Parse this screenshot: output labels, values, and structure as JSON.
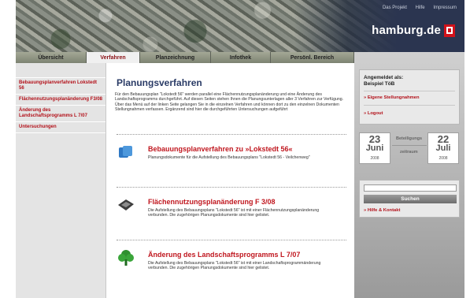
{
  "header": {
    "top_links": [
      "Das Projekt",
      "Hilfe",
      "Impressum"
    ],
    "logo_text": "hamburg.de"
  },
  "tabs": [
    {
      "label": "Übersicht",
      "active": false
    },
    {
      "label": "Verfahren",
      "active": true
    },
    {
      "label": "Planzeichnung",
      "active": false
    },
    {
      "label": "Infothek",
      "active": false
    },
    {
      "label": "Persönl. Bereich",
      "active": false
    }
  ],
  "sidebar": {
    "items": [
      {
        "label": "Bebauungsplanverfahren Lokstedt 56"
      },
      {
        "label": "Flächennutzungsplanänderung F3/08"
      },
      {
        "label": "Änderung des Landschaftsprogramms L 7/07"
      },
      {
        "label": "Untersuchungen"
      }
    ]
  },
  "main": {
    "title": "Planungsverfahren",
    "intro": "Für den Bebauungsplan \"Lokstedt 56\" werden parallel eine Flächennutzungsplanänderung und eine Änderung des Landschaftsprogramms durchgeführt. Auf diesen Seiten stehen Ihnen die Planungsunterlagen aller 3 Verfahren zur Verfügung. Über das Menü auf der linken Seite gelangen Sie in die einzelnen Verfahren und können dort zu den einzelnen Dokumenten Stellungnahmen verfassen. Ergänzend sind hier die durchgeführten Untersuchungen aufgeführt",
    "entries": [
      {
        "title": "Bebauungsplanverfahren zu »Lokstedt 56«",
        "desc": "Planungsdokumente für die Aufstellung des Bebauungsplans \"Lokstedt 56 - Veilchenweg\"",
        "icon": "document-stack-icon"
      },
      {
        "title": "Flächennutzungsplanänderung F 3/08",
        "desc": "Die Aufstellung des Bebauungsplans \"Lokstedt 56\" ist mit einer Flächennutzungsplanänderung verbunden. Die zugehörigen Planungsdokumente sind hier gelistet.",
        "icon": "map-plan-icon"
      },
      {
        "title": "Änderung des Landschaftsprogramms L 7/07",
        "desc": "Die Aufstellung des Bebauungsplans \"Lokstedt 56\" ist mit einer Landschaftsprogrammänderung verbunden. Die zugehörigen Planungsdokumente sind hier gelistet.",
        "icon": "tree-icon"
      }
    ]
  },
  "right": {
    "login_label": "Angemeldet als:",
    "login_user": "Beispiel TöB",
    "link_statements": "» Eigene Stellungnahmen",
    "link_logout": "» Logout",
    "date_start": {
      "day": "23",
      "month": "Juni",
      "year": "2008"
    },
    "date_end": {
      "day": "22",
      "month": "Juli",
      "year": "2008"
    },
    "range_label_1": "Beteiligungs",
    "range_label_2": "zeitraum",
    "search_value": "",
    "search_button": "Suchen",
    "help_link": "» Hilfe & Kontakt"
  },
  "colors": {
    "accent_red": "#c0171f",
    "title_blue": "#2a3b66",
    "header_dark": "#2b3550"
  }
}
